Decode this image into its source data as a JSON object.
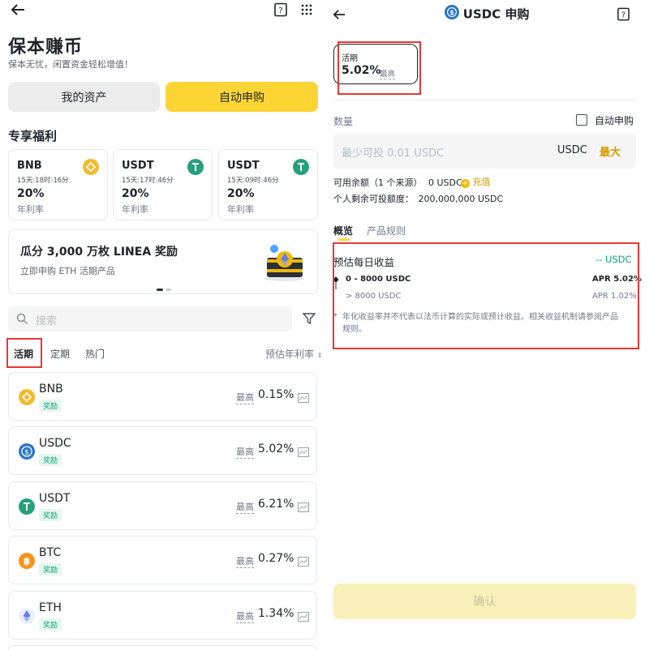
{
  "colors": {
    "brand_yellow": "#fcd535",
    "green": "#0ca678",
    "highlight_red": "#e53935",
    "gold_text": "#d89b00"
  },
  "left": {
    "header": {
      "back_icon": "arrow-left-icon",
      "book_icon": "book-icon",
      "grid_icon": "grid-icon"
    },
    "title": "保本赚币",
    "subtitle": "保本无忧，闲置资金轻松增值！",
    "buttons": {
      "my_assets": "我的资产",
      "auto_subscribe": "自动申购"
    },
    "perks_title": "专享福利",
    "perks": [
      {
        "asset": "BNB",
        "countdown": "15天:18时:16分",
        "apr": "20%",
        "apr_label": "年利率",
        "color": "#f3ba2f"
      },
      {
        "asset": "USDT",
        "countdown": "15天:17时:46分",
        "apr": "20%",
        "apr_label": "年利率",
        "color": "#26a17b"
      },
      {
        "asset": "USDT",
        "countdown": "15天:09时:46分",
        "apr": "20%",
        "apr_label": "年利率",
        "color": "#26a17b"
      }
    ],
    "banner": {
      "title": "瓜分 3,000 万枚 LINEA 奖励",
      "subtitle": "立即申购 ETH 活期产品"
    },
    "search": {
      "placeholder": "搜索"
    },
    "tabs": [
      "活期",
      "定期",
      "热门"
    ],
    "sort_label": "预估年利率",
    "assets": [
      {
        "name": "BNB",
        "tag": "奖励",
        "high_label": "最高",
        "apr": "0.15%",
        "color": "#f3ba2f"
      },
      {
        "name": "USDC",
        "tag": "奖励",
        "high_label": "最高",
        "apr": "5.02%",
        "color": "#2775ca"
      },
      {
        "name": "USDT",
        "tag": "奖励",
        "high_label": "最高",
        "apr": "6.21%",
        "color": "#26a17b"
      },
      {
        "name": "BTC",
        "tag": "奖励",
        "high_label": "最高",
        "apr": "0.27%",
        "color": "#f7931a"
      },
      {
        "name": "ETH",
        "tag": "奖励",
        "high_label": "最高",
        "apr": "1.34%",
        "color": "#627eea"
      }
    ]
  },
  "right": {
    "title": "USDC 申购",
    "product": {
      "type": "活期",
      "apr": "5.02%",
      "high_label": "最高"
    },
    "quantity_label": "数量",
    "auto_subscribe_label": "自动申购",
    "amount": {
      "placeholder": "最少可投 0.01 USDC",
      "currency": "USDC",
      "max_label": "最大"
    },
    "available": {
      "label": "可用余额（1 个来源）",
      "value": "0 USDC",
      "recharge": "充值"
    },
    "personal_limit": {
      "label": "个人剩余可投额度：",
      "value": "200,000,000 USDC"
    },
    "tabs": [
      "概览",
      "产品规则"
    ],
    "daily_earnings": {
      "label": "预估每日收益",
      "value": "-- USDC"
    },
    "tiers": [
      {
        "range": "0 - 8000 USDC",
        "apr": "APR 5.02%"
      },
      {
        "range": "> 8000 USDC",
        "apr": "APR 1.02%"
      }
    ],
    "disclaimer": "年化收益率并不代表以法币计算的实际或预计收益。相关收益机制请参阅产品规则。",
    "confirm_label": "确认"
  }
}
